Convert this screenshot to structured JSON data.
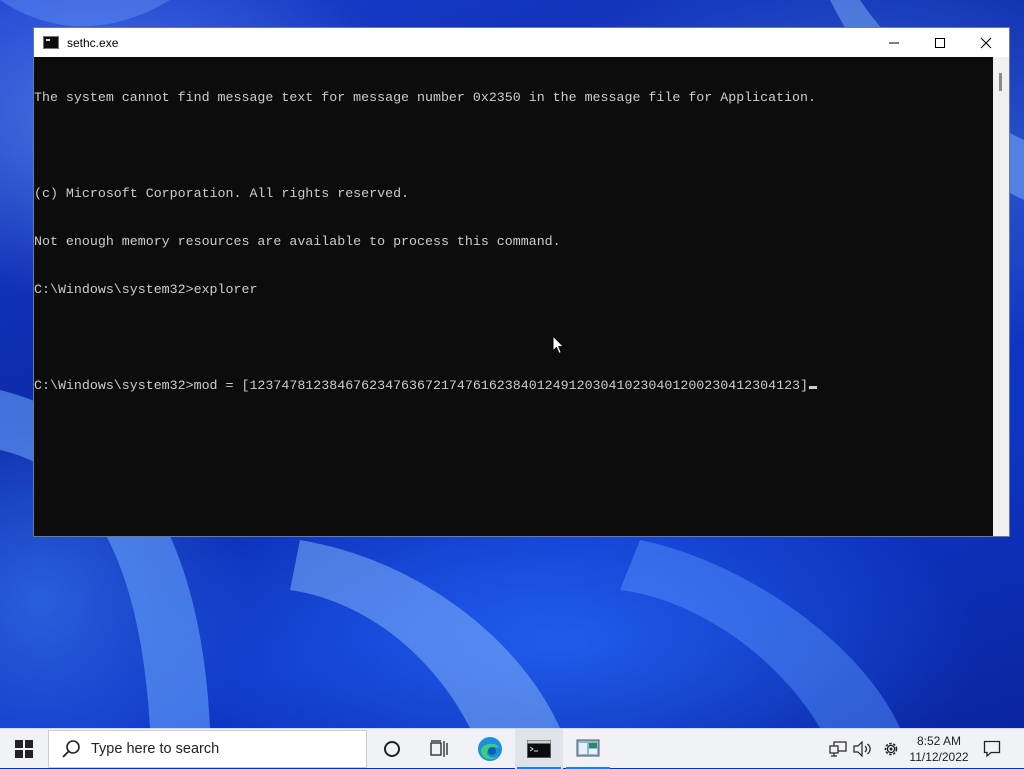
{
  "window": {
    "title": "sethc.exe",
    "minimize_icon": "minimize-icon",
    "maximize_icon": "maximize-icon",
    "close_icon": "close-icon"
  },
  "console": {
    "lines": [
      "The system cannot find message text for message number 0x2350 in the message file for Application.",
      "",
      "(c) Microsoft Corporation. All rights reserved.",
      "Not enough memory resources are available to process this command.",
      "C:\\Windows\\system32>explorer",
      "",
      "C:\\Windows\\system32>mod = [123747812384676234763672174761623840124912030410230401200230412304123]"
    ]
  },
  "taskbar": {
    "search_placeholder": "Type here to search",
    "clock_time": "8:52 AM",
    "clock_date": "11/12/2022",
    "icons": [
      "windows-start-icon",
      "search-icon",
      "cortana-icon",
      "task-view-icon",
      "edge-icon",
      "cmd-icon",
      "remote-desktop-icon",
      "network-icon",
      "volume-icon",
      "settings-icon",
      "notification-icon"
    ],
    "accent_color": "#2b7ad6"
  }
}
